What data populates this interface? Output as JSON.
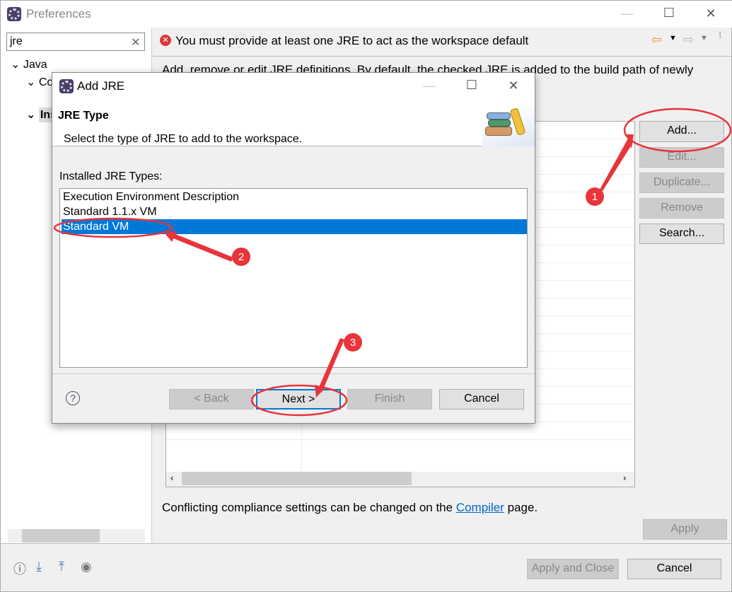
{
  "window": {
    "title": "Preferences",
    "minimize": "—",
    "maximize": "☐",
    "close": "✕"
  },
  "filter": {
    "value": "jre",
    "clear": "✕"
  },
  "tree": [
    {
      "label": "Java",
      "chevron": "⌄"
    },
    {
      "label": "Co",
      "chevron": "⌄"
    },
    {
      "label": "Ins",
      "chevron": "⌄"
    }
  ],
  "header": {
    "error_message": "You must provide at least one JRE to act as the workspace default",
    "error_icon": "error-circle-icon"
  },
  "page": {
    "description": "Add, remove or edit JRE definitions. By default, the checked JRE is added to the build path of newly",
    "buttons": {
      "add": "Add...",
      "edit": "Edit...",
      "duplicate": "Duplicate...",
      "remove": "Remove",
      "search": "Search..."
    },
    "compiler_note": {
      "before": "Conflicting compliance settings can be changed on the ",
      "link": "Compiler",
      "after": " page."
    },
    "apply": "Apply"
  },
  "footer": {
    "apply_close": "Apply and Close",
    "cancel": "Cancel"
  },
  "dialog": {
    "title": "Add JRE",
    "heading": "JRE Type",
    "subtitle": "Select the type of JRE to add to the workspace.",
    "list_label": "Installed JRE Types:",
    "items": [
      "Execution Environment Description",
      "Standard 1.1.x VM",
      "Standard VM"
    ],
    "selected_index": 2,
    "buttons": {
      "back": "< Back",
      "next": "Next >",
      "finish": "Finish",
      "cancel": "Cancel"
    }
  },
  "annotations": {
    "color": "#e8343a",
    "steps": [
      "1",
      "2",
      "3"
    ]
  },
  "colors": {
    "selection": "#0078d7",
    "link": "#0066cc"
  }
}
